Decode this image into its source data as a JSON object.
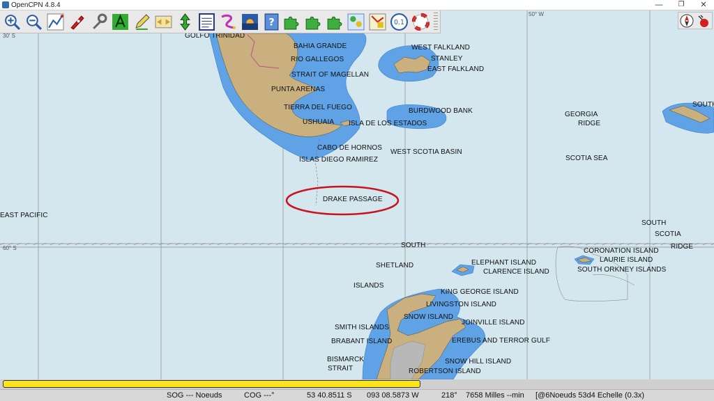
{
  "window": {
    "title": "OpenCPN 4.8.4",
    "min": "—",
    "max": "❐",
    "close": "✕"
  },
  "toolbar": {
    "buttons": [
      {
        "name": "zoom-in-button",
        "icon": "zoom-in-icon"
      },
      {
        "name": "zoom-out-button",
        "icon": "zoom-out-icon"
      },
      {
        "name": "route-button",
        "icon": "route-icon"
      },
      {
        "name": "ship-button",
        "icon": "ship-icon"
      },
      {
        "name": "tools-button",
        "icon": "wrench-icon"
      },
      {
        "name": "text-button",
        "icon": "text-a-icon"
      },
      {
        "name": "measure-button",
        "icon": "pencil-icon"
      },
      {
        "name": "chart-quilt-button",
        "icon": "chart-icon"
      },
      {
        "name": "north-up-button",
        "icon": "north-arrow-icon"
      },
      {
        "name": "route-manager-button",
        "icon": "list-icon"
      },
      {
        "name": "tracks-button",
        "icon": "track-icon"
      },
      {
        "name": "tides-button",
        "icon": "sunset-icon"
      },
      {
        "name": "help-button",
        "icon": "help-icon"
      },
      {
        "name": "plugin-1-button",
        "icon": "puzzle-icon"
      },
      {
        "name": "plugin-2-button",
        "icon": "puzzle-icon"
      },
      {
        "name": "plugin-3-button",
        "icon": "puzzle-icon"
      },
      {
        "name": "settings-button",
        "icon": "settings-icon"
      },
      {
        "name": "radar-button",
        "icon": "radar-icon"
      },
      {
        "name": "grib-button",
        "icon": "grib-icon"
      },
      {
        "name": "sos-button",
        "icon": "lifebuoy-icon"
      }
    ],
    "grib_label": "0.1"
  },
  "grid_labels": {
    "lat_top": "30' S",
    "lon_top": "50° W",
    "lat_mid": "60° S"
  },
  "places": {
    "golfo_trinidad": "GOLFO TRINIDAD",
    "bahia_grande": "BAHIA GRANDE",
    "rio_gallegos": "RIO GALLEGOS",
    "strait_magellan": "STRAIT OF MAGELLAN",
    "punta_arenas": "PUNTA ARENAS",
    "tierra_del_fuego": "TIERRA DEL FUEGO",
    "ushuaia": "USHUAIA",
    "isla_estados": "ISLA DE LOS ESTADOS",
    "cabo_hornos": "CABO DE HORNOS",
    "islas_diego": "ISLAS DIEGO RAMIREZ",
    "drake_passage": "DRAKE PASSAGE",
    "west_falkland": "WEST FALKLAND",
    "stanley": "STANLEY",
    "east_falkland": "EAST FALKLAND",
    "burdwood_bank": "BURDWOOD BANK",
    "west_scotia_basin": "WEST SCOTIA BASIN",
    "georgia": "GEORGIA",
    "ridge": "RIDGE",
    "scotia_sea": "SCOTIA SEA",
    "south_georgia": "SOUTH",
    "east_pacific": "EAST PACIFIC",
    "south_shetland_1": "SOUTH",
    "south_shetland_2": "SHETLAND",
    "south_shetland_3": "ISLANDS",
    "south_scotia_1": "SOUTH",
    "south_scotia_2": "SCOTIA",
    "south_scotia_3": "RIDGE",
    "coronation": "CORONATION ISLAND",
    "laurie": "LAURIE ISLAND",
    "south_orkney": "SOUTH ORKNEY ISLANDS",
    "elephant": "ELEPHANT ISLAND",
    "clarence": "CLARENCE ISLAND",
    "king_george": "KING GEORGE ISLAND",
    "livingston": "LIVINGSTON ISLAND",
    "snow": "SNOW ISLAND",
    "joinville": "JOINVILLE ISLAND",
    "smith": "SMITH ISLANDS",
    "brabant": "BRABANT ISLAND",
    "erebus": "EREBUS AND TERROR GULF",
    "bismarck_1": "BISMARCK",
    "bismarck_2": "STRAIT",
    "snow_hill": "SNOW HILL ISLAND",
    "robertson": "ROBERTSON ISLAND"
  },
  "progress": {
    "value": 0.59
  },
  "status": {
    "sog": "SOG --- Noeuds",
    "cog": "COG ---°",
    "lat": "53 40.8511 S",
    "lon": "093 08.5873 W",
    "bearing": "218°",
    "distance": "7658 Milles --min",
    "scale": "[@6Noeuds 53d4 Echelle (0.3x)"
  },
  "colors": {
    "sea": "#d4e6ee",
    "shallow": "#5fa3e6",
    "land": "#c9b07e",
    "ice": "#b8b8b8",
    "highlight": "#c8141e",
    "progress": "#fde51a"
  }
}
